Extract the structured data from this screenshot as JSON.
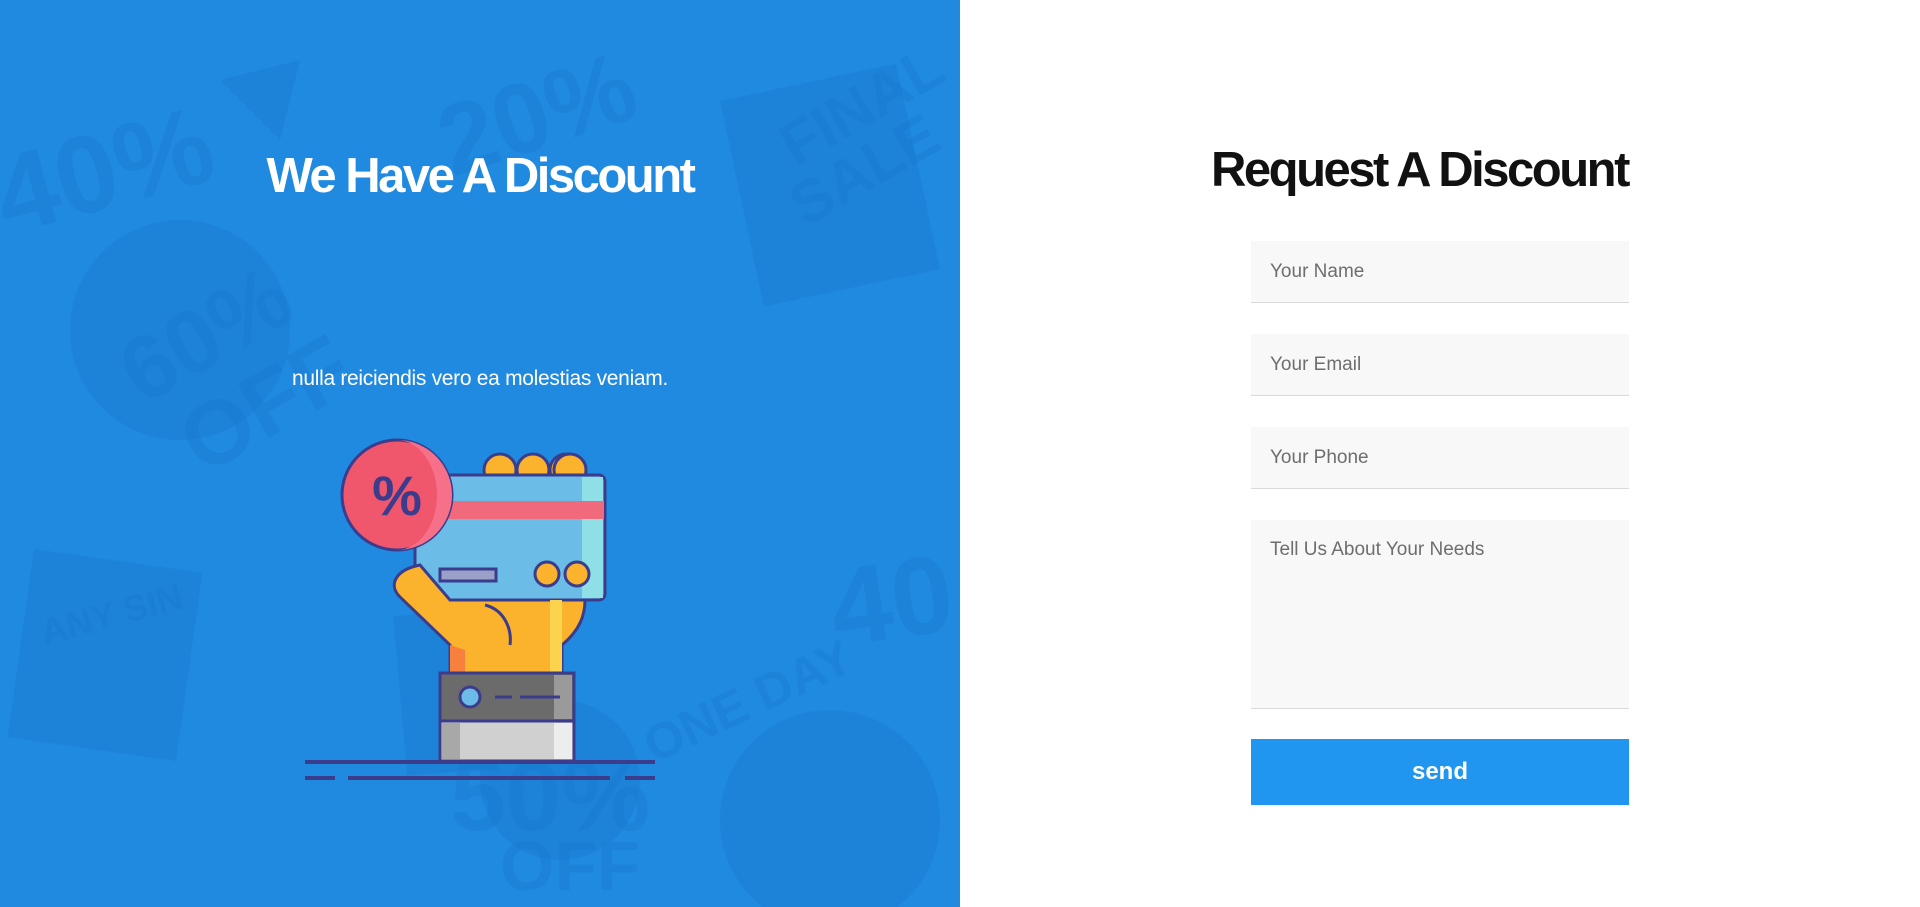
{
  "left": {
    "title": "We Have A Discount",
    "description": "nulla reiciendis vero ea molestias veniam.",
    "illustration_icon": "hand-holding-discount-card-icon",
    "background_color": "#1f8ae0"
  },
  "form": {
    "title": "Request A Discount",
    "name_placeholder": "Your Name",
    "email_placeholder": "Your Email",
    "phone_placeholder": "Your Phone",
    "needs_placeholder": "Tell Us About Your Needs",
    "send_label": "send",
    "button_color": "#2196f0"
  }
}
